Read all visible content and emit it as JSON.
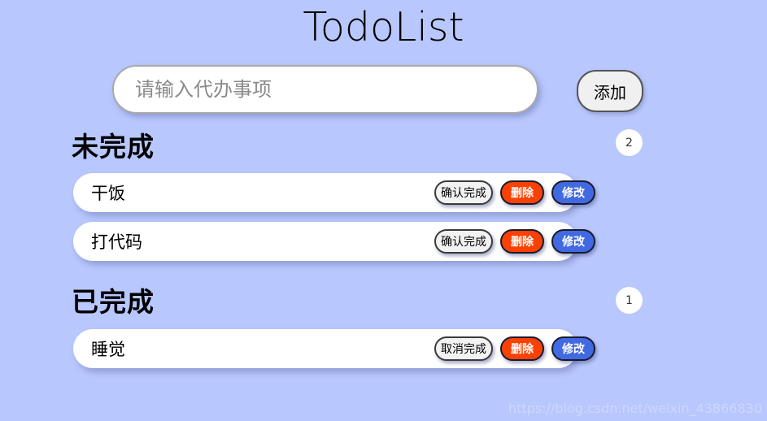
{
  "app": {
    "title": "TodoList",
    "background_color": "#b8c7fd"
  },
  "input_row": {
    "placeholder": "请输入代办事项",
    "value": "",
    "add_label": "添加"
  },
  "sections": [
    {
      "header": "未完成",
      "count": "2",
      "tasks": [
        {
          "label": "干饭",
          "toggle_label": "确认完成",
          "delete_label": "删除",
          "edit_label": "修改"
        },
        {
          "label": "打代码",
          "toggle_label": "确认完成",
          "delete_label": "删除",
          "edit_label": "修改"
        }
      ]
    },
    {
      "header": "已完成",
      "count": "1",
      "tasks": [
        {
          "label": "睡觉",
          "toggle_label": "取消完成",
          "delete_label": "删除",
          "edit_label": "修改"
        }
      ]
    }
  ],
  "watermark": {
    "text": "https://blog.csdn.net/weixin_43866830"
  },
  "colors": {
    "delete_button": "#fa4104",
    "edit_button": "#4169e1",
    "page_background": "#b8c7fd"
  }
}
